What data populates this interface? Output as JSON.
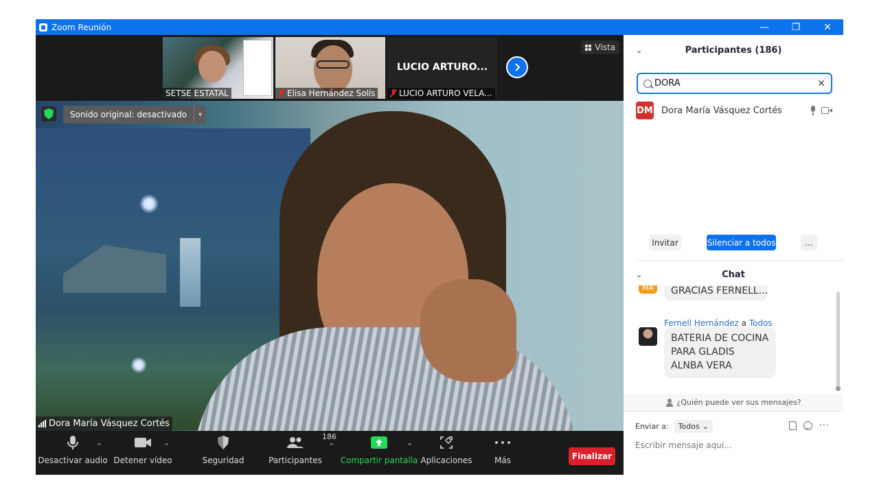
{
  "window": {
    "title": "Zoom Reunión",
    "controls": {
      "minimize": "—",
      "restore": "❐",
      "close": "✕"
    }
  },
  "video": {
    "thumbnails": [
      {
        "name": "SETSE ESTATAL",
        "muted": false
      },
      {
        "name": "Elisa Hernández Solís",
        "muted": true
      },
      {
        "name": "LUCIO ARTURO VELA...",
        "display_name": "LUCIO ARTURO...",
        "muted": true
      }
    ],
    "view_button": "Vista",
    "sound_original": "Sonido original: desactivado",
    "active_speaker": "Dora María Vásquez Cortés"
  },
  "toolbar": {
    "audio": "Desactivar audio",
    "video": "Detener vídeo",
    "security": "Seguridad",
    "participants": "Participantes",
    "participants_count": "186",
    "share": "Compartir pantalla",
    "apps": "Aplicaciones",
    "more": "Más",
    "end": "Finalizar",
    "colors": {
      "share_green": "#23d959",
      "end_red": "#dc1f2c"
    }
  },
  "participants_panel": {
    "title": "Participantes (186)",
    "search_value": "DORA",
    "results": [
      {
        "initials": "DM",
        "name": "Dora María Vásquez Cortés",
        "avatar_color": "#d2312e"
      }
    ],
    "invite": "Invitar",
    "mute_all": "Silenciar a todos",
    "more": "..."
  },
  "chat": {
    "title": "Chat",
    "messages": [
      {
        "avatar": "MA",
        "text": "GRACIAS FERNELL..."
      },
      {
        "sender": "Fernell Hernández",
        "to_word": "a",
        "to": "Todos",
        "text": "BATERIA DE COCINA PARA GLADIS ALNBA VERA"
      }
    ],
    "privacy_note": "¿Quién puede ver sus mensajes?",
    "send_to_label": "Enviar a:",
    "send_to_value": "Todos",
    "input_placeholder": "Escribir mensaje aquí..."
  }
}
